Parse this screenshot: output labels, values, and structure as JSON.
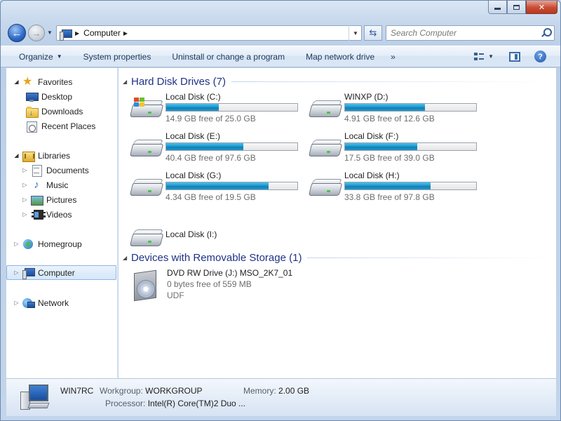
{
  "window": {
    "caption_buttons": {
      "minimize": "",
      "maximize": "",
      "close": "✕"
    }
  },
  "nav": {
    "back_glyph": "←",
    "forward_glyph": "→",
    "breadcrumb": [
      "Computer"
    ],
    "search_placeholder": "Search Computer"
  },
  "toolbar": {
    "organize": "Organize",
    "system_properties": "System properties",
    "uninstall": "Uninstall or change a program",
    "map_network_drive": "Map network drive",
    "more": "»",
    "help": "?"
  },
  "sidebar": {
    "favorites": {
      "label": "Favorites",
      "items": [
        "Desktop",
        "Downloads",
        "Recent Places"
      ]
    },
    "libraries": {
      "label": "Libraries",
      "items": [
        "Documents",
        "Music",
        "Pictures",
        "Videos"
      ]
    },
    "homegroup": "Homegroup",
    "computer": "Computer",
    "network": "Network"
  },
  "content": {
    "hard_disk_header": "Hard Disk Drives (7)",
    "removable_header": "Devices with Removable Storage (1)",
    "drives": [
      {
        "name": "Local Disk (C:)",
        "free": "14.9 GB free of 25.0 GB",
        "used_fraction": 0.4,
        "system": true
      },
      {
        "name": "WINXP (D:)",
        "free": "4.91 GB free of 12.6 GB",
        "used_fraction": 0.61,
        "system": false
      },
      {
        "name": "Local Disk (E:)",
        "free": "40.4 GB free of 97.6 GB",
        "used_fraction": 0.59,
        "system": false
      },
      {
        "name": "Local Disk (F:)",
        "free": "17.5 GB free of 39.0 GB",
        "used_fraction": 0.55,
        "system": false
      },
      {
        "name": "Local Disk (G:)",
        "free": "4.34 GB free of 19.5 GB",
        "used_fraction": 0.78,
        "system": false
      },
      {
        "name": "Local Disk (H:)",
        "free": "33.8 GB free of 97.8 GB",
        "used_fraction": 0.65,
        "system": false
      },
      {
        "name": "Local Disk (I:)",
        "free": "",
        "used_fraction": null,
        "system": false
      }
    ],
    "dvd": {
      "name": "DVD RW Drive (J:) MSO_2K7_01",
      "free": "0 bytes free of 559 MB",
      "filesystem": "UDF"
    }
  },
  "details": {
    "computer_name": "WIN7RC",
    "workgroup_label": "Workgroup:",
    "workgroup": "WORKGROUP",
    "memory_label": "Memory:",
    "memory": "2.00 GB",
    "processor_label": "Processor:",
    "processor": "Intel(R) Core(TM)2 Duo ..."
  },
  "colors": {
    "drive_fill": "#1e9ad1",
    "group_title": "#1e3287",
    "selection": "#d5e7f9"
  }
}
